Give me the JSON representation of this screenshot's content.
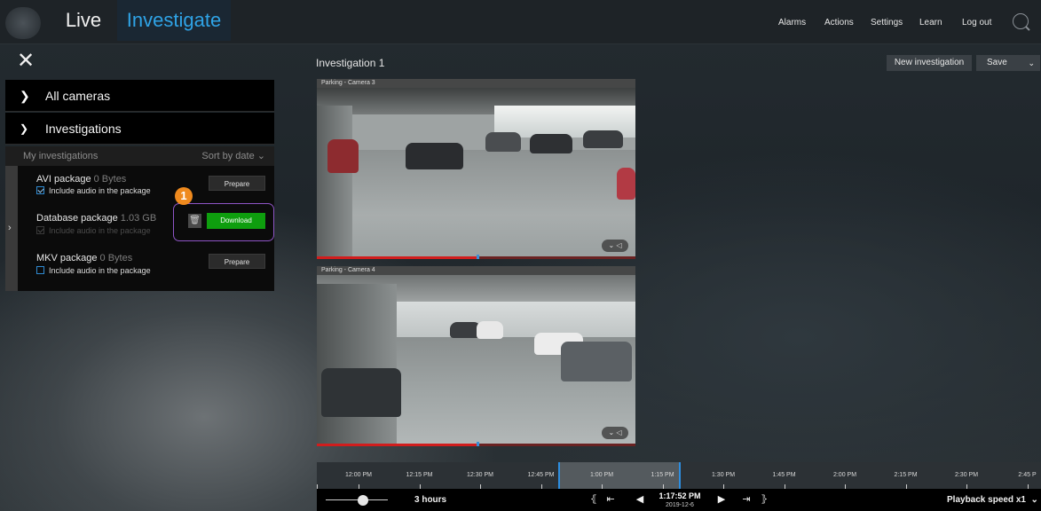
{
  "topbar": {
    "tabs": [
      {
        "label": "Live"
      },
      {
        "label": "Investigate"
      }
    ],
    "nav": [
      "Alarms",
      "Actions",
      "Settings",
      "Learn",
      "Log out"
    ]
  },
  "sidebar": {
    "all_cameras": "All cameras",
    "investigations": "Investigations",
    "my_investigations": "My investigations",
    "sort": "Sort by date",
    "packages": [
      {
        "name": "AVI package",
        "size": "0 Bytes",
        "option": "Include audio in the package",
        "checked": true,
        "button": "Prepare"
      },
      {
        "name": "Database package",
        "size": "1.03 GB",
        "option": "Include audio in the package",
        "checked": true,
        "button": "Download"
      },
      {
        "name": "MKV package",
        "size": "0 Bytes",
        "option": "Include audio in the package",
        "checked": false,
        "button": "Prepare"
      }
    ],
    "callout_number": "1"
  },
  "main": {
    "title": "Investigation 1",
    "new_investigation": "New investigation",
    "save": "Save",
    "cameras": [
      {
        "label": "Parking - Camera 3"
      },
      {
        "label": "Parking - Camera 4"
      }
    ]
  },
  "timeline": {
    "ticks": [
      "12:00 PM",
      "12:15 PM",
      "12:30 PM",
      "12:45 PM",
      "1:00 PM",
      "1:15 PM",
      "1:30 PM",
      "1:45 PM",
      "2:00 PM",
      "2:15 PM",
      "2:30 PM",
      "2:45 P"
    ]
  },
  "controls": {
    "span": "3 hours",
    "time": "1:17:52 PM",
    "date": "2019-12-6",
    "playback_speed": "Playback speed x1"
  },
  "colors": {
    "accent": "#2fa3e6",
    "download": "#0e9e0e",
    "highlight": "#8e55c6",
    "badge": "#ef8a1e"
  }
}
